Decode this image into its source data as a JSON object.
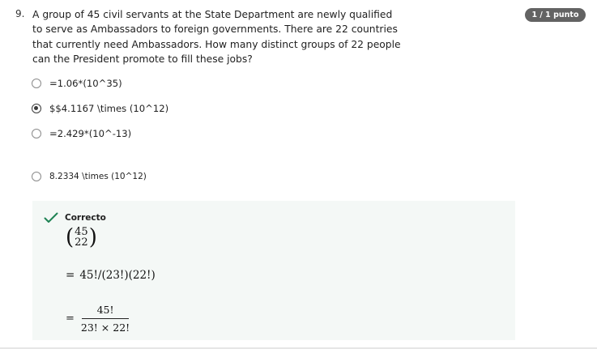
{
  "question": {
    "number": "9.",
    "text": "A group of 45 civil servants at the State Department are newly qualified to serve as Ambassadors to foreign governments. There are 22 countries that currently need Ambassadors. How many distinct groups of 22 people can the President promote to fill these jobs?",
    "score": "1 / 1 punto"
  },
  "options": [
    {
      "label": "=1.06*(10^35)",
      "selected": false
    },
    {
      "label": "$$4.1167 \\times (10^12)",
      "selected": true
    },
    {
      "label": "=2.429*(10^-13)",
      "selected": false
    },
    {
      "label": "8.2334 \\times (10^12)",
      "selected": false
    }
  ],
  "feedback": {
    "status": "Correcto",
    "status_color": "#1f8354",
    "binom_top": "45",
    "binom_bottom": "22",
    "eq_sign": "=",
    "step2": "45!/(23!)(22!)",
    "frac_numerator": "45!",
    "frac_denominator": "23! × 22!"
  },
  "colors": {
    "badge_bg": "#636363",
    "feedback_bg": "#f4f8f6"
  }
}
